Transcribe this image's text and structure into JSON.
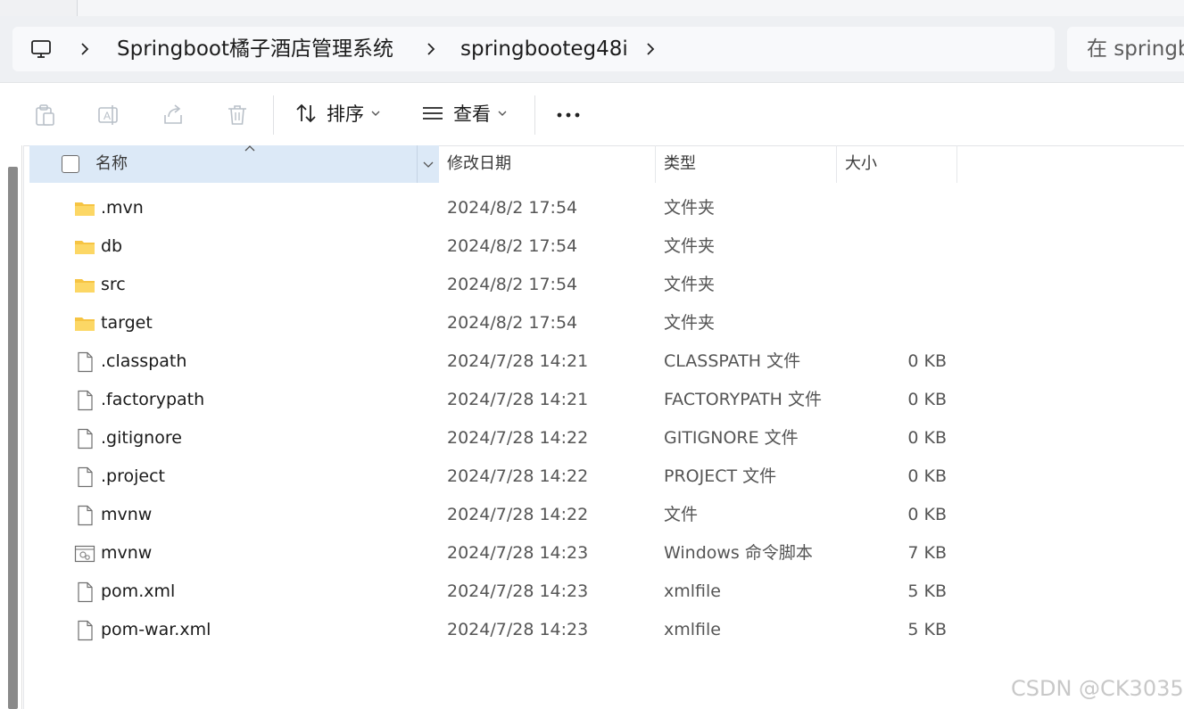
{
  "address_bar": {
    "crumbs": [
      "Springboot橘子酒店管理系统",
      "springbooteg48i"
    ],
    "search_placeholder": "在 springb"
  },
  "command_bar": {
    "sort_label": "排序",
    "view_label": "查看",
    "more_label": "···"
  },
  "columns": {
    "name": "名称",
    "date": "修改日期",
    "type": "类型",
    "size": "大小"
  },
  "files": [
    {
      "name": ".mvn",
      "date": "2024/8/2 17:54",
      "type": "文件夹",
      "size": "",
      "icon": "folder-icon"
    },
    {
      "name": "db",
      "date": "2024/8/2 17:54",
      "type": "文件夹",
      "size": "",
      "icon": "folder-icon"
    },
    {
      "name": "src",
      "date": "2024/8/2 17:54",
      "type": "文件夹",
      "size": "",
      "icon": "folder-icon"
    },
    {
      "name": "target",
      "date": "2024/8/2 17:54",
      "type": "文件夹",
      "size": "",
      "icon": "folder-icon"
    },
    {
      "name": ".classpath",
      "date": "2024/7/28 14:21",
      "type": "CLASSPATH 文件",
      "size": "0 KB",
      "icon": "file-icon"
    },
    {
      "name": ".factorypath",
      "date": "2024/7/28 14:21",
      "type": "FACTORYPATH 文件",
      "size": "0 KB",
      "icon": "file-icon"
    },
    {
      "name": ".gitignore",
      "date": "2024/7/28 14:22",
      "type": "GITIGNORE 文件",
      "size": "0 KB",
      "icon": "file-icon"
    },
    {
      "name": ".project",
      "date": "2024/7/28 14:22",
      "type": "PROJECT 文件",
      "size": "0 KB",
      "icon": "file-icon"
    },
    {
      "name": "mvnw",
      "date": "2024/7/28 14:22",
      "type": "文件",
      "size": "0 KB",
      "icon": "file-icon"
    },
    {
      "name": "mvnw",
      "date": "2024/7/28 14:23",
      "type": "Windows 命令脚本",
      "size": "7 KB",
      "icon": "script-file-icon"
    },
    {
      "name": "pom.xml",
      "date": "2024/7/28 14:23",
      "type": "xmlfile",
      "size": "5 KB",
      "icon": "file-icon"
    },
    {
      "name": "pom-war.xml",
      "date": "2024/7/28 14:23",
      "type": "xmlfile",
      "size": "5 KB",
      "icon": "file-icon"
    }
  ],
  "watermark": "CSDN @CK3035",
  "colors": {
    "header_selected": "#dce9f7",
    "folder": "#f6c443",
    "window_bg": "#eef0f3"
  }
}
